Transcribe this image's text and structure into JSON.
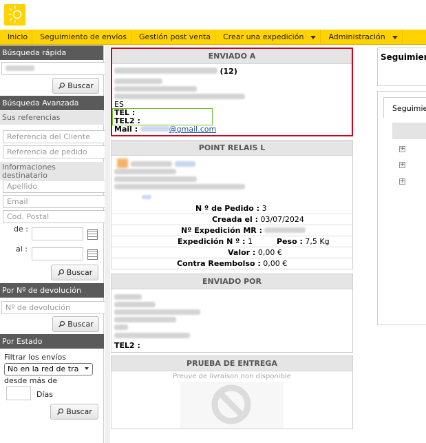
{
  "nav": {
    "items": [
      {
        "label": "Inicio",
        "dropdown": false
      },
      {
        "label": "Seguimiento de envíos",
        "dropdown": false
      },
      {
        "label": "Gestión post venta",
        "dropdown": false
      },
      {
        "label": "Crear una expedición",
        "dropdown": true
      },
      {
        "label": "Administración",
        "dropdown": true
      }
    ]
  },
  "sidebar": {
    "quick_search": {
      "title": "Búsqueda rápida",
      "button": "Buscar"
    },
    "advanced_search": {
      "title": "Búsqueda Avanzada",
      "refs_title": "Sus referencias",
      "client_ref_placeholder": "Referencia del Cliente",
      "order_ref_placeholder": "Referencia de pedido",
      "recipient_title": "Informaciones destinatario",
      "surname_placeholder": "Apellido",
      "email_placeholder": "Email",
      "postcode_placeholder": "Cod. Postal",
      "from_label": "de :",
      "to_label": "al :",
      "button": "Buscar"
    },
    "return_search": {
      "title": "Por Nº de devolución",
      "placeholder": "Nº de devolución",
      "button": "Buscar"
    },
    "status_search": {
      "title": "Por Estado",
      "filter_label": "Filtrar los envíos",
      "select_value": "No en la red de tra",
      "since_label": "desde más de",
      "days_label": "Días",
      "button": "Buscar"
    }
  },
  "sent_to": {
    "title": "ENVIADO A",
    "count": "(12)",
    "country": "ES",
    "tel_label": "TEL :",
    "tel2_label": "TEL2 :",
    "mail_label": "Mail :",
    "mail_domain": "@gmail.com"
  },
  "relay": {
    "title": "POINT RELAIS L",
    "order_no_label": "N º de Pedido :",
    "order_no_value": "3",
    "created_label": "Creada el :",
    "created_value": "03/07/2024",
    "mr_label": "Nº Expedición MR :",
    "expedition_label": "Expedición N º :",
    "expedition_value": "1",
    "weight_label": "Peso :",
    "weight_value": "7,5 Kg",
    "value_label": "Valor :",
    "value_value": "0,00 €",
    "cod_label": "Contra Reembolso :",
    "cod_value": "0,00 €"
  },
  "sent_by": {
    "title": "ENVIADO POR",
    "tel2_label": "TEL2 :"
  },
  "proof": {
    "title": "PRUEBA DE ENTREGA",
    "note": "Preuve de livraison non disponible"
  },
  "right": {
    "title": "Seguimien",
    "tab": "Seguimie"
  },
  "colors": {
    "brand_yellow": "#ffd200",
    "highlight_red": "#d0021b",
    "highlight_green": "#6fbf2a",
    "link_blue": "#1a4fa0"
  }
}
